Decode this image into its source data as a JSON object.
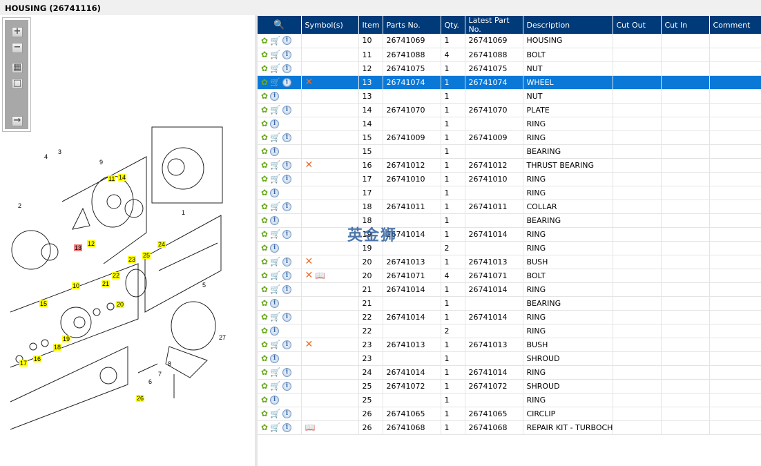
{
  "title": "HOUSING (26741116)",
  "watermark": "英金狮",
  "toolbar": [
    {
      "icon": "zoom-in-icon",
      "glyph": "+"
    },
    {
      "icon": "zoom-out-icon",
      "glyph": "−"
    },
    {
      "icon": "fit-all-icon",
      "glyph": "▦"
    },
    {
      "icon": "fit-window-icon",
      "glyph": "□"
    },
    {
      "icon": "export-icon",
      "glyph": "→"
    }
  ],
  "diagram_callouts": [
    "4",
    "3",
    "9",
    "11",
    "14",
    "2",
    "1",
    "13",
    "12",
    "24",
    "23",
    "25",
    "22",
    "21",
    "10",
    "15",
    "20",
    "19",
    "18",
    "16",
    "17",
    "5",
    "27",
    "6",
    "7",
    "8",
    "26"
  ],
  "highlight_colors": {
    "callout": "#ffff00",
    "selected_callout": "#f08080",
    "header": "#003a78",
    "selected_row": "#0a78d7"
  },
  "columns": [
    "",
    "Symbol(s)",
    "Item",
    "Parts No.",
    "Qty.",
    "Latest Part No.",
    "Description",
    "Cut Out",
    "Cut In",
    "Comment"
  ],
  "rows": [
    {
      "cart": true,
      "sym": [],
      "item": "10",
      "part": "26741069",
      "qty": "1",
      "latest": "26741069",
      "desc": "HOUSING"
    },
    {
      "cart": true,
      "sym": [],
      "item": "11",
      "part": "26741088",
      "qty": "4",
      "latest": "26741088",
      "desc": "BOLT"
    },
    {
      "cart": true,
      "sym": [],
      "item": "12",
      "part": "26741075",
      "qty": "1",
      "latest": "26741075",
      "desc": "NUT"
    },
    {
      "cart": true,
      "sym": [
        "x"
      ],
      "item": "13",
      "part": "26741074",
      "qty": "1",
      "latest": "26741074",
      "desc": "WHEEL",
      "selected": true
    },
    {
      "cart": false,
      "sym": [],
      "item": "13",
      "part": "",
      "qty": "1",
      "latest": "",
      "desc": "NUT"
    },
    {
      "cart": true,
      "sym": [],
      "item": "14",
      "part": "26741070",
      "qty": "1",
      "latest": "26741070",
      "desc": "PLATE"
    },
    {
      "cart": false,
      "sym": [],
      "item": "14",
      "part": "",
      "qty": "1",
      "latest": "",
      "desc": "RING"
    },
    {
      "cart": true,
      "sym": [],
      "item": "15",
      "part": "26741009",
      "qty": "1",
      "latest": "26741009",
      "desc": "RING"
    },
    {
      "cart": false,
      "sym": [],
      "item": "15",
      "part": "",
      "qty": "1",
      "latest": "",
      "desc": "BEARING"
    },
    {
      "cart": true,
      "sym": [
        "x"
      ],
      "item": "16",
      "part": "26741012",
      "qty": "1",
      "latest": "26741012",
      "desc": "THRUST BEARING"
    },
    {
      "cart": true,
      "sym": [],
      "item": "17",
      "part": "26741010",
      "qty": "1",
      "latest": "26741010",
      "desc": "RING"
    },
    {
      "cart": false,
      "sym": [],
      "item": "17",
      "part": "",
      "qty": "1",
      "latest": "",
      "desc": "RING"
    },
    {
      "cart": true,
      "sym": [],
      "item": "18",
      "part": "26741011",
      "qty": "1",
      "latest": "26741011",
      "desc": "COLLAR"
    },
    {
      "cart": false,
      "sym": [],
      "item": "18",
      "part": "",
      "qty": "1",
      "latest": "",
      "desc": "BEARING"
    },
    {
      "cart": true,
      "sym": [],
      "item": "19",
      "part": "26741014",
      "qty": "1",
      "latest": "26741014",
      "desc": "RING"
    },
    {
      "cart": false,
      "sym": [],
      "item": "19",
      "part": "",
      "qty": "2",
      "latest": "",
      "desc": "RING"
    },
    {
      "cart": true,
      "sym": [
        "x"
      ],
      "item": "20",
      "part": "26741013",
      "qty": "1",
      "latest": "26741013",
      "desc": "BUSH"
    },
    {
      "cart": true,
      "sym": [
        "x",
        "book"
      ],
      "item": "20",
      "part": "26741071",
      "qty": "4",
      "latest": "26741071",
      "desc": "BOLT"
    },
    {
      "cart": true,
      "sym": [],
      "item": "21",
      "part": "26741014",
      "qty": "1",
      "latest": "26741014",
      "desc": "RING"
    },
    {
      "cart": false,
      "sym": [],
      "item": "21",
      "part": "",
      "qty": "1",
      "latest": "",
      "desc": "BEARING"
    },
    {
      "cart": true,
      "sym": [],
      "item": "22",
      "part": "26741014",
      "qty": "1",
      "latest": "26741014",
      "desc": "RING"
    },
    {
      "cart": false,
      "sym": [],
      "item": "22",
      "part": "",
      "qty": "2",
      "latest": "",
      "desc": "RING"
    },
    {
      "cart": true,
      "sym": [
        "x"
      ],
      "item": "23",
      "part": "26741013",
      "qty": "1",
      "latest": "26741013",
      "desc": "BUSH"
    },
    {
      "cart": false,
      "sym": [],
      "item": "23",
      "part": "",
      "qty": "1",
      "latest": "",
      "desc": "SHROUD"
    },
    {
      "cart": true,
      "sym": [],
      "item": "24",
      "part": "26741014",
      "qty": "1",
      "latest": "26741014",
      "desc": "RING"
    },
    {
      "cart": true,
      "sym": [],
      "item": "25",
      "part": "26741072",
      "qty": "1",
      "latest": "26741072",
      "desc": "SHROUD"
    },
    {
      "cart": false,
      "sym": [],
      "item": "25",
      "part": "",
      "qty": "1",
      "latest": "",
      "desc": "RING"
    },
    {
      "cart": true,
      "sym": [],
      "item": "26",
      "part": "26741065",
      "qty": "1",
      "latest": "26741065",
      "desc": "CIRCLIP"
    },
    {
      "cart": true,
      "sym": [
        "book"
      ],
      "item": "26",
      "part": "26741068",
      "qty": "1",
      "latest": "26741068",
      "desc": "REPAIR KIT - TURBOCHARGER"
    }
  ]
}
